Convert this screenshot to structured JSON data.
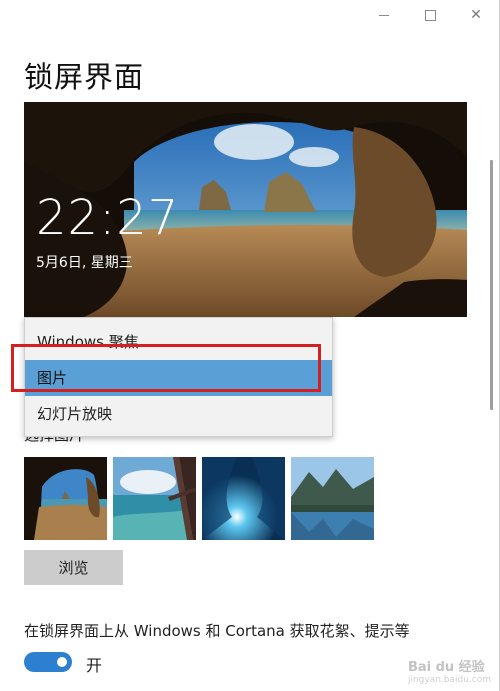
{
  "window": {
    "title": "锁屏界面",
    "controls": [
      "minimize",
      "maximize",
      "close"
    ]
  },
  "preview": {
    "time": "22:27",
    "date": "5月6日, 星期三"
  },
  "background_dropdown": {
    "options": [
      {
        "label": "Windows 聚焦",
        "selected": false
      },
      {
        "label": "图片",
        "selected": true
      },
      {
        "label": "幻灯片放映",
        "selected": false
      }
    ],
    "highlight_color": "#d32020",
    "selected_color": "#5a9fd6"
  },
  "choose_picture_label": "选择图片",
  "thumbnails": [
    {
      "name": "cave-beach"
    },
    {
      "name": "beach-window"
    },
    {
      "name": "underwater-light"
    },
    {
      "name": "mountain-lake"
    }
  ],
  "browse_label": "浏览",
  "tips": {
    "label": "在锁屏界面上从 Windows 和 Cortana 获取花絮、提示等",
    "toggle_state": "开",
    "toggle_on": true,
    "accent": "#2c7fd1"
  },
  "watermark": {
    "brand": "Bai du 经验",
    "sub": "jingyan.baidu.com"
  }
}
